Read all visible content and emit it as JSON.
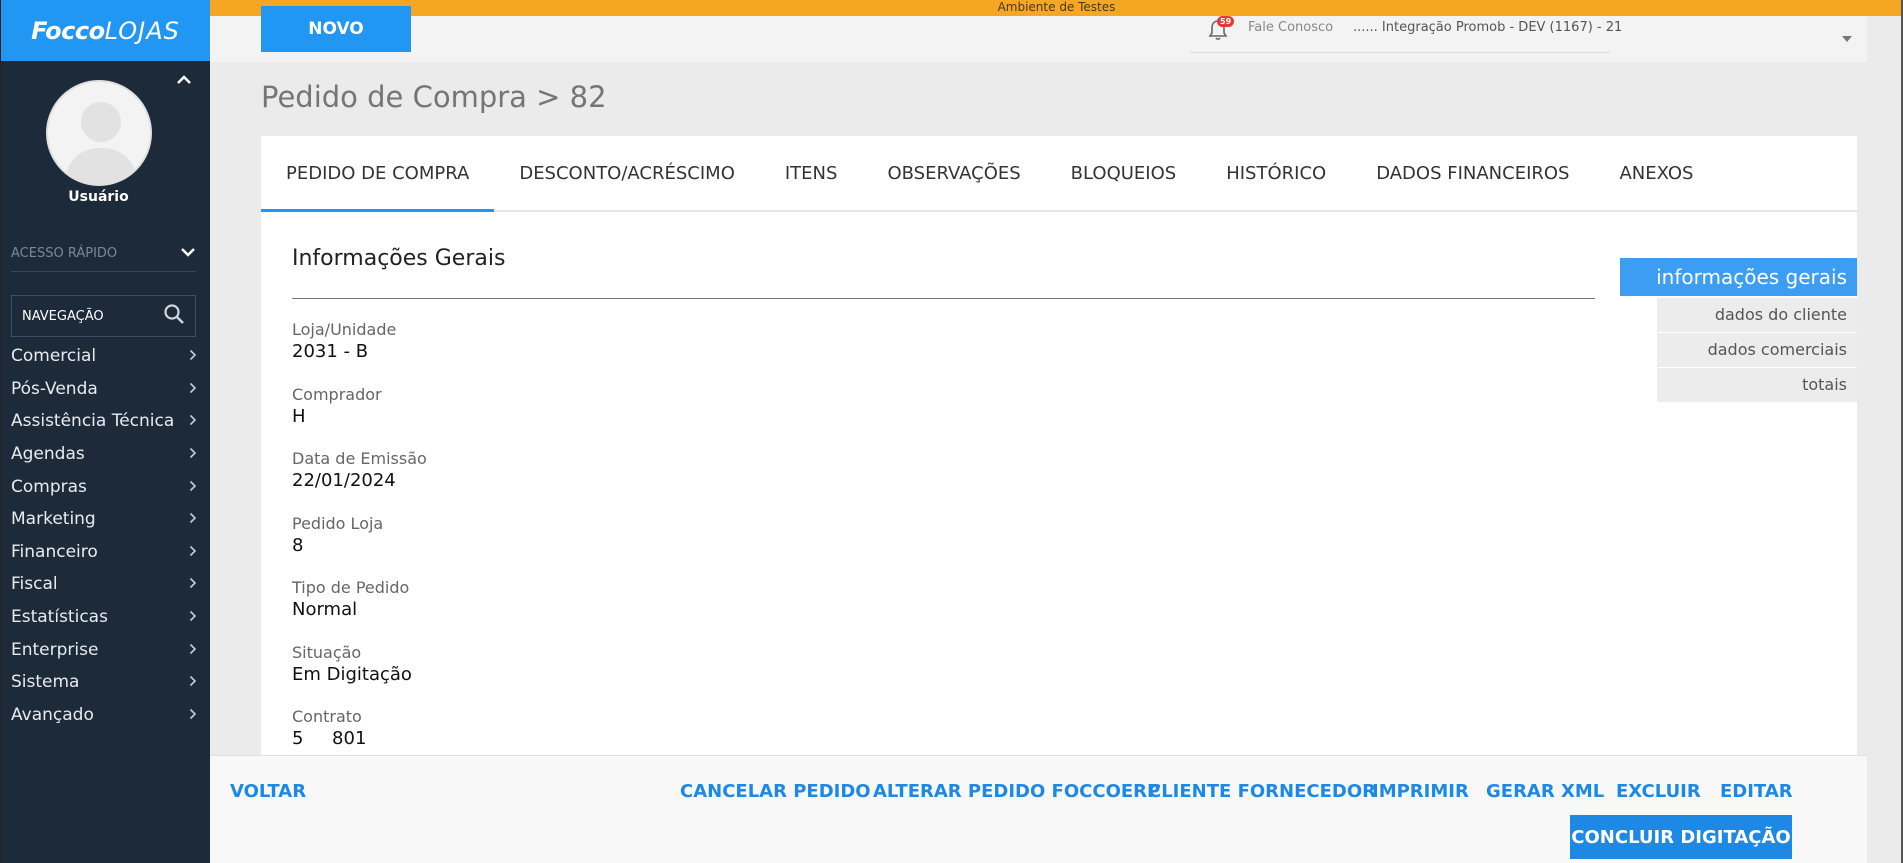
{
  "env_banner": "Ambiente de Testes",
  "sidebar": {
    "logo_bold": "Focco",
    "logo_light": "LOJAS",
    "username": "Usuário",
    "quick_access": "ACESSO RÁPIDO",
    "nav_search": "NAVEGAÇÃO",
    "items": [
      {
        "label": "Comercial"
      },
      {
        "label": "Pós-Venda"
      },
      {
        "label": "Assistência Técnica"
      },
      {
        "label": "Agendas"
      },
      {
        "label": "Compras"
      },
      {
        "label": "Marketing"
      },
      {
        "label": "Financeiro"
      },
      {
        "label": "Fiscal"
      },
      {
        "label": "Estatísticas"
      },
      {
        "label": "Enterprise"
      },
      {
        "label": "Sistema"
      },
      {
        "label": "Avançado"
      }
    ]
  },
  "topbar": {
    "new_button": "NOVO",
    "notification_count": "59",
    "contact_link": "Fale Conosco",
    "environment": "...... Integração Promob - DEV (1167) - 21"
  },
  "page": {
    "title": "Pedido de Compra > 82"
  },
  "tabs": [
    {
      "label": "PEDIDO DE COMPRA",
      "active": true
    },
    {
      "label": "DESCONTO/ACRÉSCIMO"
    },
    {
      "label": "ITENS"
    },
    {
      "label": "OBSERVAÇÕES"
    },
    {
      "label": "BLOQUEIOS"
    },
    {
      "label": "HISTÓRICO"
    },
    {
      "label": "DADOS FINANCEIROS"
    },
    {
      "label": "ANEXOS"
    }
  ],
  "section": {
    "title": "Informações Gerais",
    "fields": [
      {
        "label": "Loja/Unidade",
        "value": "2031 - B"
      },
      {
        "label": "Comprador",
        "value": "H"
      },
      {
        "label": "Data de Emissão",
        "value": "22/01/2024"
      },
      {
        "label": "Pedido Loja",
        "value": "8"
      },
      {
        "label": "Tipo de Pedido",
        "value": "Normal"
      },
      {
        "label": "Situação",
        "value": "Em Digitação"
      },
      {
        "label": "Contrato",
        "value": "5     801"
      }
    ]
  },
  "side_nav": [
    {
      "label": "informações gerais",
      "active": true
    },
    {
      "label": "dados do cliente"
    },
    {
      "label": "dados comerciais"
    },
    {
      "label": "totais"
    }
  ],
  "actions": {
    "back": "VOLTAR",
    "cancel": "CANCELAR PEDIDO",
    "alter": "ALTERAR PEDIDO FOCCOERP",
    "supplier": "CLIENTE FORNECEDOR",
    "print": "IMPRIMIR",
    "xml": "GERAR XML",
    "delete": "EXCLUIR",
    "edit": "EDITAR",
    "conclude": "CONCLUIR DIGITAÇÃO"
  },
  "colors": {
    "accent": "#2196f3",
    "sidebar_bg": "#1c2a3a",
    "env_banner": "#f5a623"
  }
}
